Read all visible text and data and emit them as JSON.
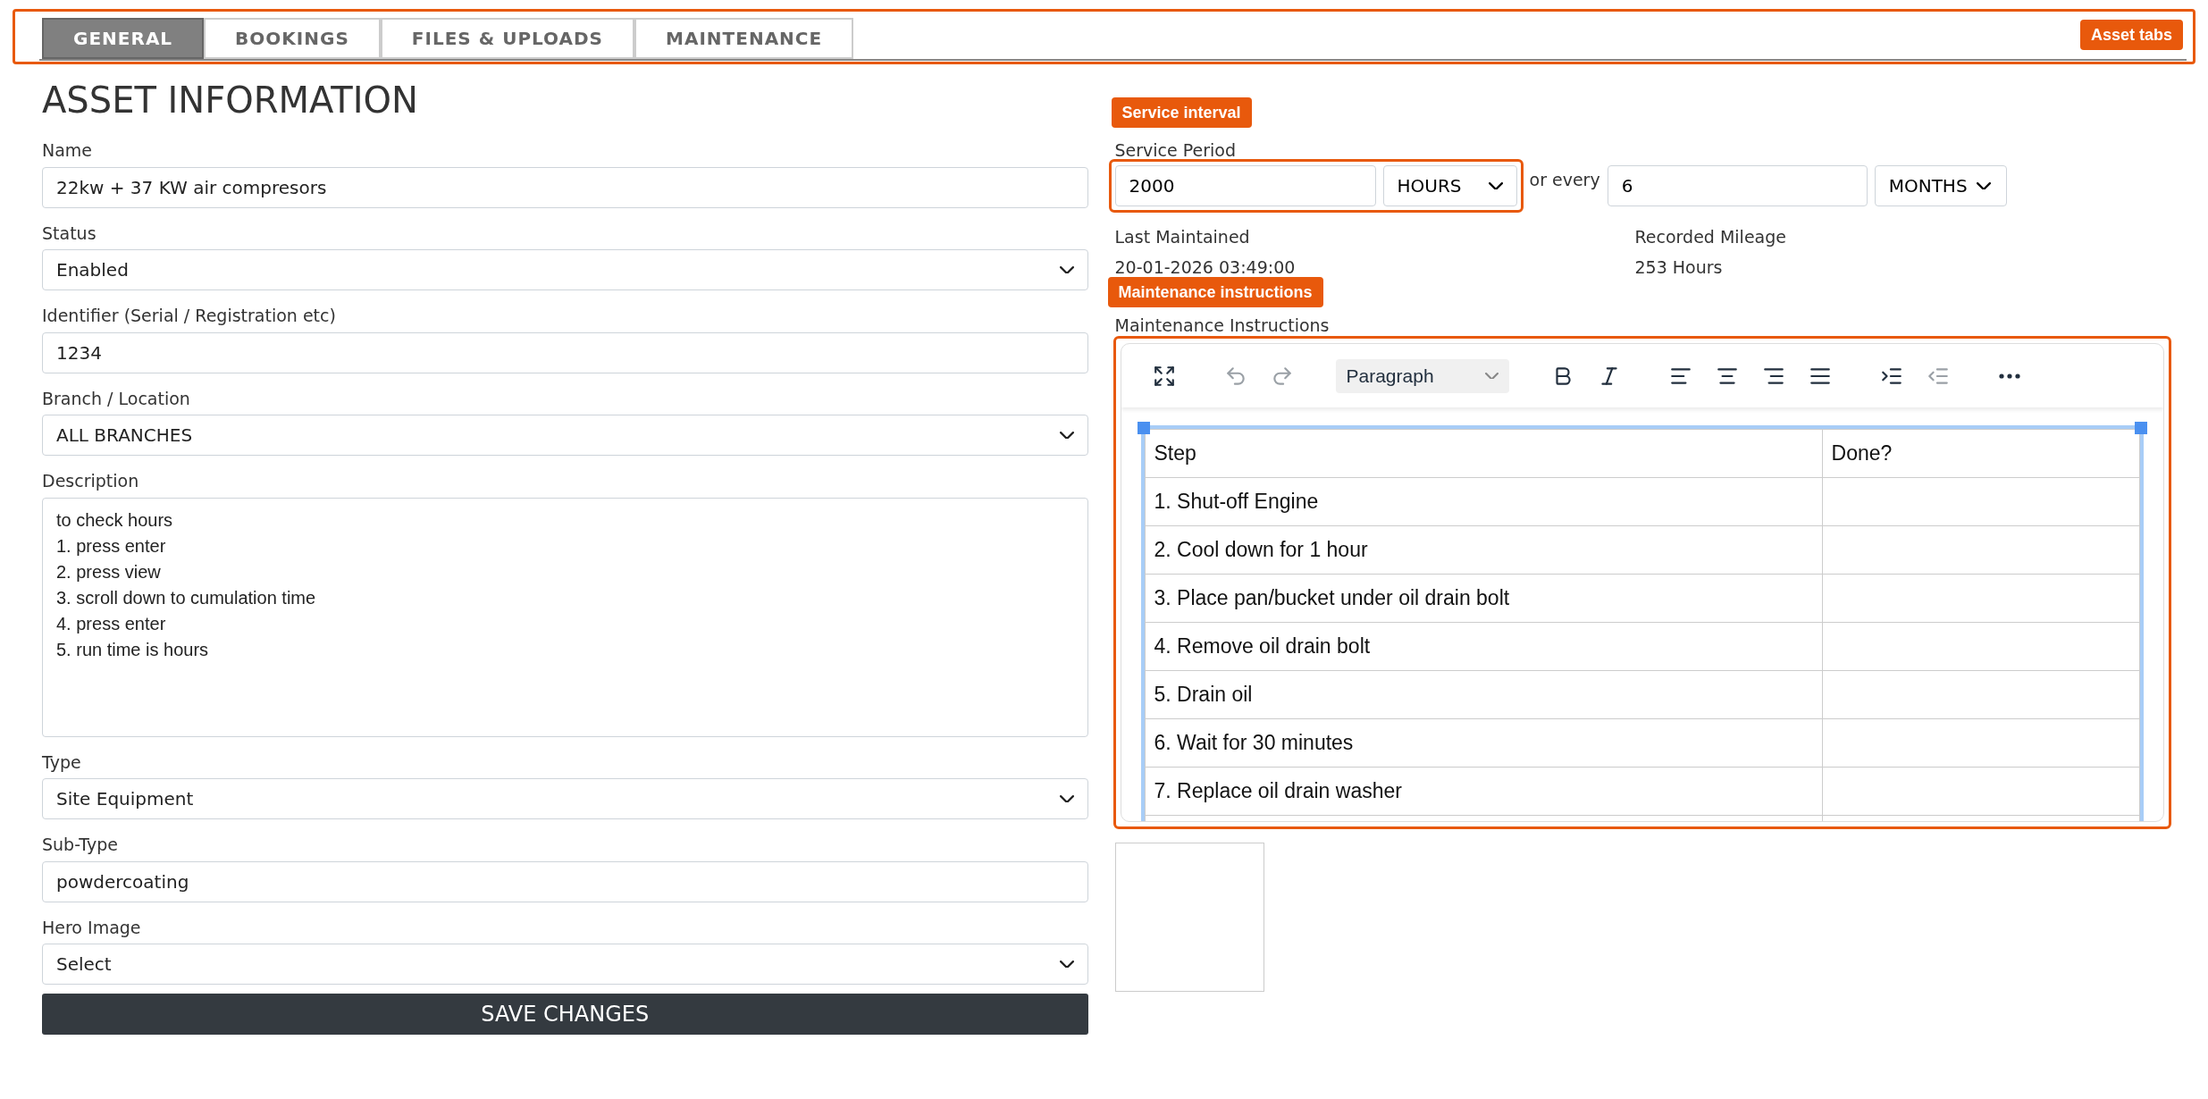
{
  "tab_bar": {
    "callout": "Asset tabs",
    "tabs": [
      {
        "label": "GENERAL",
        "selected": true
      },
      {
        "label": "BOOKINGS",
        "selected": false
      },
      {
        "label": "FILES & UPLOADS",
        "selected": false
      },
      {
        "label": "MAINTENANCE",
        "selected": false
      }
    ]
  },
  "title": "ASSET INFORMATION",
  "fields": [
    {
      "kind": "input",
      "label": "Name",
      "value": "22kw + 37 KW air compresors"
    },
    {
      "kind": "select",
      "label": "Status",
      "value": "Enabled"
    },
    {
      "kind": "input",
      "label": "Identifier (Serial / Registration etc)",
      "value": "1234"
    },
    {
      "kind": "select",
      "label": "Branch / Location",
      "value": "ALL BRANCHES"
    },
    {
      "kind": "textarea",
      "label": "Description",
      "value": "to check hours\n1. press enter\n2. press view\n3. scroll down to cumulation time\n4. press enter\n5. run time is hours"
    },
    {
      "kind": "select",
      "label": "Type",
      "value": "Site Equipment"
    },
    {
      "kind": "input",
      "label": "Sub-Type",
      "value": "powdercoating"
    },
    {
      "kind": "select",
      "label": "Hero Image",
      "value": "Select"
    }
  ],
  "save_button": "SAVE CHANGES",
  "service_period": {
    "callout": "Service interval",
    "label": "Service Period",
    "value": "2000",
    "unit": "HOURS",
    "or_label": "or every",
    "alt_value": "6",
    "alt_unit": "MONTHS"
  },
  "info": [
    {
      "label": "Last Maintained",
      "value": "20-01-2026 03:49:00"
    },
    {
      "label": "Recorded Mileage",
      "value": "253 Hours"
    }
  ],
  "maintenance": {
    "callout": "Maintenance instructions",
    "label": "Maintenance Instructions",
    "toolbar": [
      {
        "kind": "fullscreen",
        "disabled": false
      },
      {
        "kind": "undo",
        "disabled": true
      },
      {
        "kind": "redo",
        "disabled": true
      },
      {
        "kind": "format",
        "label": "Paragraph",
        "disabled": false
      },
      {
        "kind": "bold",
        "disabled": false
      },
      {
        "kind": "italic",
        "disabled": false
      },
      {
        "kind": "align-left",
        "disabled": false
      },
      {
        "kind": "align-center",
        "disabled": false
      },
      {
        "kind": "align-right",
        "disabled": false
      },
      {
        "kind": "justify",
        "disabled": false
      },
      {
        "kind": "indent",
        "disabled": false
      },
      {
        "kind": "outdent",
        "disabled": true
      },
      {
        "kind": "more",
        "disabled": false
      }
    ],
    "table_selected": true,
    "columns": [
      "Step",
      "Done?"
    ],
    "rows": [
      [
        "1. Shut-off Engine",
        ""
      ],
      [
        "2. Cool down for 1 hour",
        ""
      ],
      [
        "3. Place pan/bucket under oil drain bolt",
        ""
      ],
      [
        "4. Remove oil drain bolt",
        ""
      ],
      [
        "5. Drain oil",
        ""
      ],
      [
        "6. Wait for 30 minutes",
        ""
      ],
      [
        "7. Replace oil drain washer",
        ""
      ]
    ]
  }
}
